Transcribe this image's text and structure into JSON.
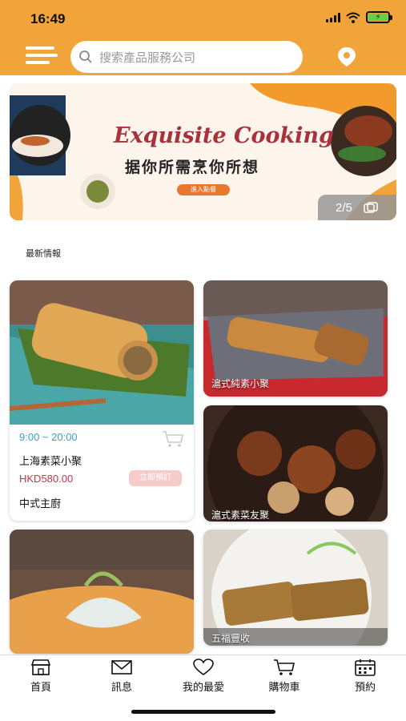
{
  "status_bar": {
    "time": "16:49"
  },
  "header": {
    "search_placeholder": "搜索產品服務公司"
  },
  "banner": {
    "title": "Exquisite Cooking",
    "subtitle": "据你所需烹你所想",
    "button_label": "進入點餐",
    "counter": "2/5"
  },
  "section_title": "最新情報",
  "cards": {
    "featured": {
      "hours": "9:00 ~ 20:00",
      "name": "上海素菜小聚",
      "price": "HKD580.00",
      "order_label": "立即預訂",
      "category": "中式主廚"
    },
    "item2": {
      "label": "滬式純素小聚"
    },
    "item3": {
      "label": "滬式素菜友聚"
    },
    "item5": {
      "label": "五福豐收"
    }
  },
  "tabbar": {
    "items": [
      {
        "label": "首頁"
      },
      {
        "label": "訊息"
      },
      {
        "label": "我的最愛"
      },
      {
        "label": "購物車"
      },
      {
        "label": "預約"
      }
    ]
  },
  "colors": {
    "brand": "#f0a43a",
    "price": "#c8344a",
    "hours": "#3aa0d6"
  }
}
